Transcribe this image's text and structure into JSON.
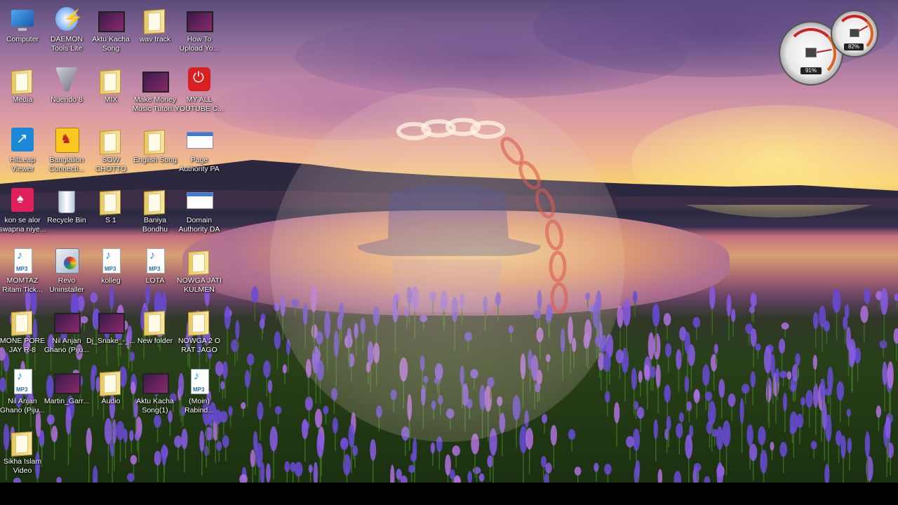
{
  "desktop": {
    "icons": [
      {
        "id": "computer",
        "label": "Computer",
        "icon": "computer-icon"
      },
      {
        "id": "daemon",
        "label": "DAEMON\nTools Lite",
        "icon": "daemon-tools-icon"
      },
      {
        "id": "aktu-kacha-song",
        "label": "Aktu Kacha\nSong",
        "icon": "video-file-icon"
      },
      {
        "id": "wav-track",
        "label": "wav track",
        "icon": "folder-icon"
      },
      {
        "id": "how-to-upload",
        "label": "How To\nUpload Yo...",
        "icon": "video-file-icon"
      },
      {
        "id": "media",
        "label": "Media",
        "icon": "folder-icon"
      },
      {
        "id": "nuendo",
        "label": "Nuendo 8",
        "icon": "nuendo-icon"
      },
      {
        "id": "mix",
        "label": "MIX",
        "icon": "folder-icon"
      },
      {
        "id": "make-money",
        "label": "Make Money\nMusic Tutori...",
        "icon": "video-file-icon"
      },
      {
        "id": "my-all-youtube",
        "label": "MY ALL\nYOUTUBE C...",
        "icon": "power-icon"
      },
      {
        "id": "hitleap",
        "label": "HitLeap\nViewer",
        "icon": "hitleap-icon"
      },
      {
        "id": "banglalion",
        "label": "Banglalion\nConnecti...",
        "icon": "banglalion-icon"
      },
      {
        "id": "sow-chotto",
        "label": "SOW\nCHOTTO",
        "icon": "folder-icon"
      },
      {
        "id": "english-song",
        "label": "English Song",
        "icon": "folder-icon"
      },
      {
        "id": "page-authority",
        "label": "Page\nAuthority PA",
        "icon": "web-document-icon"
      },
      {
        "id": "kon-se-alor",
        "label": "kon se alor\nswapna niye...",
        "icon": "music-app-icon"
      },
      {
        "id": "recycle-bin",
        "label": "Recycle Bin",
        "icon": "recycle-bin-icon"
      },
      {
        "id": "s1",
        "label": "S 1",
        "icon": "folder-icon"
      },
      {
        "id": "baniya-bondhu",
        "label": "Baniya\nBondhu",
        "icon": "folder-icon"
      },
      {
        "id": "domain-authority",
        "label": "Domain\nAuthority DA",
        "icon": "web-document-icon"
      },
      {
        "id": "momtaz",
        "label": "MOMTAZ\nRitam Tick...",
        "icon": "mp3-file-icon"
      },
      {
        "id": "revo",
        "label": "Revo\nUninstaller",
        "icon": "revo-uninstaller-icon"
      },
      {
        "id": "kolleg",
        "label": "kolleg",
        "icon": "mp3-file-icon"
      },
      {
        "id": "lota",
        "label": "LOTA",
        "icon": "mp3-file-icon"
      },
      {
        "id": "nowga-jati",
        "label": "NOWGA JATI\nKULMEN",
        "icon": "folder-icon"
      },
      {
        "id": "mone-pore",
        "label": "MONE PORE\nJAY R-8",
        "icon": "folder-icon"
      },
      {
        "id": "nil-anjan-1",
        "label": "Nil Anjan\nGhano (Piju...",
        "icon": "video-file-icon"
      },
      {
        "id": "dj-snake",
        "label": "Dj_Snake_-_...",
        "icon": "video-file-icon"
      },
      {
        "id": "new-folder",
        "label": "New folder",
        "icon": "folder-icon"
      },
      {
        "id": "nowga-2",
        "label": "NOWGA 2 O\nRAT JAGO",
        "icon": "folder-icon"
      },
      {
        "id": "nil-anjan-2",
        "label": "Nil Anjan\nGhano (Piju...",
        "icon": "mp3-file-icon"
      },
      {
        "id": "martin-garrix",
        "label": "Martin_Garr...",
        "icon": "video-file-icon"
      },
      {
        "id": "audio",
        "label": "Audio",
        "icon": "folder-icon"
      },
      {
        "id": "aktu-kacha-song-1",
        "label": "Aktu Kacha\nSong(1)",
        "icon": "video-file-icon"
      },
      {
        "id": "moin-rabind",
        "label": "(Moin)\nRabind...",
        "icon": "mp3-file-icon"
      },
      {
        "id": "sikha-islam",
        "label": "Sikha Islam\nVideo",
        "icon": "folder-icon"
      }
    ]
  },
  "gadgets": {
    "cpu_meter": {
      "value_label": "91%",
      "icon": "cpu-meter-gadget-icon"
    },
    "memory_meter": {
      "value_label": "82%",
      "icon": "memory-meter-gadget-icon"
    }
  },
  "overlay": {
    "icon": "chain-shield-watermark-icon"
  },
  "colors": {
    "label_text": "#ffffff",
    "taskbar": "#000000",
    "gauge_red": "#d02020"
  }
}
